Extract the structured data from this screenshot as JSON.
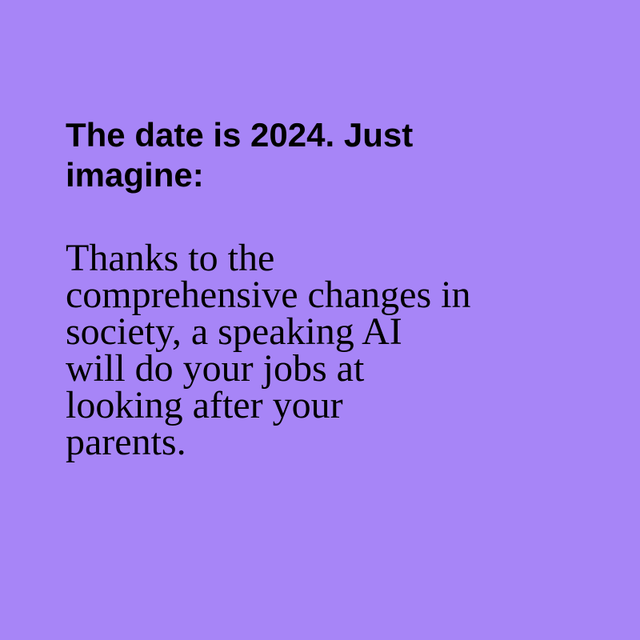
{
  "colors": {
    "background": "#a785f7",
    "text": "#000000"
  },
  "heading": {
    "lines": [
      "The date is 2024. Just",
      "imagine:"
    ]
  },
  "body": {
    "lines": [
      "Thanks to the",
      "comprehensive changes in",
      "society, a speaking AI",
      "will do your jobs at",
      "looking after your",
      "parents."
    ]
  }
}
